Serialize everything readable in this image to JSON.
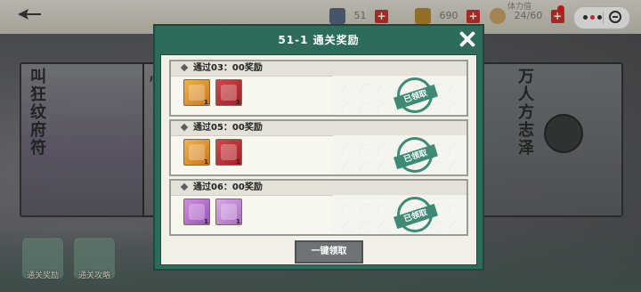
{
  "topbar": {
    "res1_value": "51",
    "res2_value": "690",
    "res3_value": "24/60",
    "res3_sub": "体力值"
  },
  "bg": {
    "left_title": "叫狂纹府符",
    "left2_title": "心",
    "right_title": "万人方志泽"
  },
  "side_buttons": [
    {
      "label": "通关奖励"
    },
    {
      "label": "通关攻略"
    }
  ],
  "dialog": {
    "title": "51-1 通关奖励",
    "rows": [
      {
        "label": "通过03：00奖励",
        "items": [
          {
            "icon": "scroll",
            "count": "1"
          },
          {
            "icon": "chest",
            "count": "1"
          }
        ],
        "stamp": "已领取"
      },
      {
        "label": "通过05：00奖励",
        "items": [
          {
            "icon": "scroll",
            "count": "1"
          },
          {
            "icon": "chest",
            "count": "1"
          }
        ],
        "stamp": "已领取"
      },
      {
        "label": "通过06：00奖励",
        "items": [
          {
            "icon": "purple-gem",
            "count": "1"
          },
          {
            "icon": "purple-scroll",
            "count": "1"
          }
        ],
        "stamp": "已领取"
      }
    ],
    "claim_all": "一键领取"
  },
  "colors": {
    "dialog_frame": "#2d6b5b",
    "stamp": "#3e8a75",
    "plus": "#c8332e"
  }
}
